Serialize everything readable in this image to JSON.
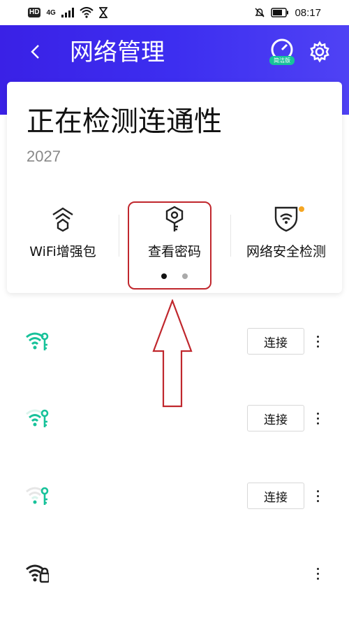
{
  "status_bar": {
    "hd": "HD",
    "signal": "4G",
    "time": "08:17"
  },
  "header": {
    "title": "网络管理",
    "speed_tag": "简洁版"
  },
  "status_card": {
    "title": "正在检测连通性",
    "subtitle": "2027",
    "features": [
      {
        "label": "WiFi增强包",
        "icon": "wifi-boost-icon"
      },
      {
        "label": "查看密码",
        "icon": "key-icon"
      },
      {
        "label": "网络安全检测",
        "icon": "wifi-shield-icon"
      }
    ],
    "pager": {
      "count": 2,
      "active": 0
    }
  },
  "wifi_list": [
    {
      "connect_label": "连接",
      "icon": "wifi-key-icon",
      "signal": "full"
    },
    {
      "connect_label": "连接",
      "icon": "wifi-key-icon",
      "signal": "medium"
    },
    {
      "connect_label": "连接",
      "icon": "wifi-key-icon",
      "signal": "weak"
    },
    {
      "connect_label": "",
      "icon": "wifi-lock-icon",
      "signal": "full"
    }
  ],
  "colors": {
    "header": "#3d2ef0",
    "accent_green": "#17c29a",
    "badge_orange": "#f5a623",
    "annotation_red": "#c0272d"
  }
}
